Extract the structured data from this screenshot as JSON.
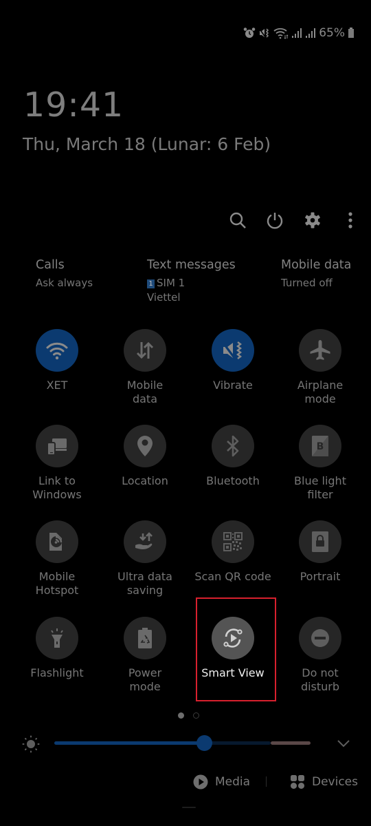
{
  "status_bar": {
    "icons": [
      "alarm-icon",
      "vibrate-icon",
      "wifi-icon",
      "signal-sim1-icon",
      "signal-sim2-icon",
      "battery-icon"
    ],
    "battery": "65%"
  },
  "clock": {
    "time": "19:41",
    "date": "Thu, March 18 (Lunar: 6 Feb)"
  },
  "top_actions": [
    "search-icon",
    "power-icon",
    "settings-icon",
    "more-options-icon"
  ],
  "sim_info": {
    "calls": {
      "title": "Calls",
      "value": "Ask always"
    },
    "text_messages": {
      "title": "Text messages",
      "sim_badge": "1",
      "value": "SIM 1",
      "carrier": "Viettel"
    },
    "mobile_data": {
      "title": "Mobile data",
      "value": "Turned off"
    }
  },
  "tiles": [
    {
      "label": "XET",
      "icon": "wifi-icon",
      "state": "on"
    },
    {
      "label": "Mobile\ndata",
      "icon": "mobile-data-icon",
      "state": "off"
    },
    {
      "label": "Vibrate",
      "icon": "vibrate-icon",
      "state": "on"
    },
    {
      "label": "Airplane\nmode",
      "icon": "airplane-icon",
      "state": "off"
    },
    {
      "label": "Link to\nWindows",
      "icon": "link-to-windows-icon",
      "state": "off"
    },
    {
      "label": "Location",
      "icon": "location-icon",
      "state": "off"
    },
    {
      "label": "Bluetooth",
      "icon": "bluetooth-icon",
      "state": "off"
    },
    {
      "label": "Blue light\nfilter",
      "icon": "blue-light-filter-icon",
      "state": "off"
    },
    {
      "label": "Mobile\nHotspot",
      "icon": "hotspot-icon",
      "state": "off"
    },
    {
      "label": "Ultra data\nsaving",
      "icon": "data-saving-icon",
      "state": "off"
    },
    {
      "label": "Scan QR code",
      "icon": "qr-code-icon",
      "state": "off"
    },
    {
      "label": "Portrait",
      "icon": "portrait-lock-icon",
      "state": "off"
    },
    {
      "label": "Flashlight",
      "icon": "flashlight-icon",
      "state": "off"
    },
    {
      "label": "Power\nmode",
      "icon": "power-mode-icon",
      "state": "off"
    },
    {
      "label": "Smart View",
      "icon": "smart-view-icon",
      "state": "highlighted"
    },
    {
      "label": "Do not\ndisturb",
      "icon": "do-not-disturb-icon",
      "state": "off"
    }
  ],
  "pagination": {
    "current": 1,
    "total": 2
  },
  "brightness": {
    "level_percent": 59
  },
  "bottom": {
    "media_label": "Media",
    "devices_label": "Devices"
  },
  "colors": {
    "accent": "#0b3a70",
    "highlight_border": "#d8202e",
    "background": "#000000"
  }
}
